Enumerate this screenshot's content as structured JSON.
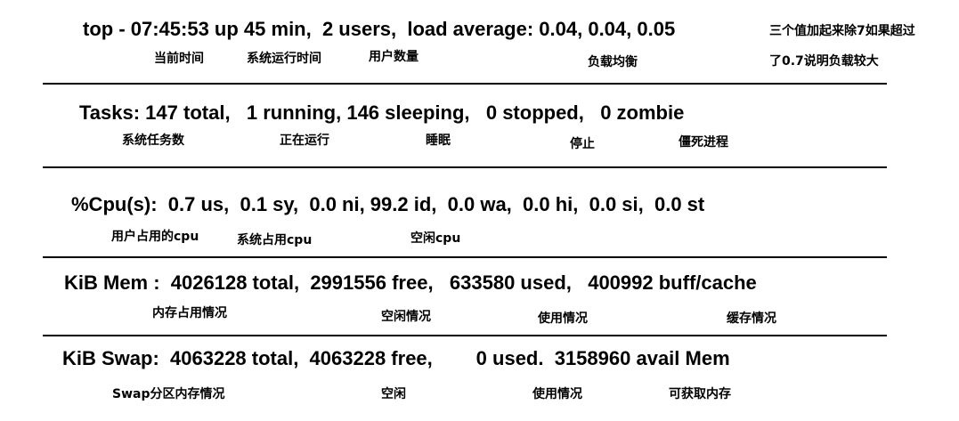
{
  "line1": {
    "text": "top - 07:45:53 up 45 min,  2 users,  load average: 0.04, 0.04, 0.05",
    "side_note": [
      "三个值加起来除7如果超过",
      "了0.7说明负载较大"
    ],
    "labels": [
      "当前时间",
      "系统运行时间",
      "用户数量",
      "负载均衡"
    ]
  },
  "line2": {
    "text": "Tasks: 147 total,   1 running, 146 sleeping,   0 stopped,   0 zombie",
    "labels": [
      "系统任务数",
      "正在运行",
      "睡眠",
      "停止",
      "僵死进程"
    ]
  },
  "line3": {
    "text": "%Cpu(s):  0.7 us,  0.1 sy,  0.0 ni, 99.2 id,  0.0 wa,  0.0 hi,  0.0 si,  0.0 st",
    "labels": [
      "用户占用的cpu",
      "系统占用cpu",
      "空闲cpu"
    ]
  },
  "line4": {
    "text": "KiB Mem :  4026128 total,  2991556 free,   633580 used,   400992 buff/cache",
    "labels": [
      "内存占用情况",
      "空闲情况",
      "使用情况",
      "缓存情况"
    ]
  },
  "line5": {
    "text": "KiB Swap:  4063228 total,  4063228 free,        0 used.  3158960 avail Mem",
    "labels": [
      "Swap分区内存情况",
      "空闲",
      "使用情况",
      "可获取内存"
    ]
  }
}
